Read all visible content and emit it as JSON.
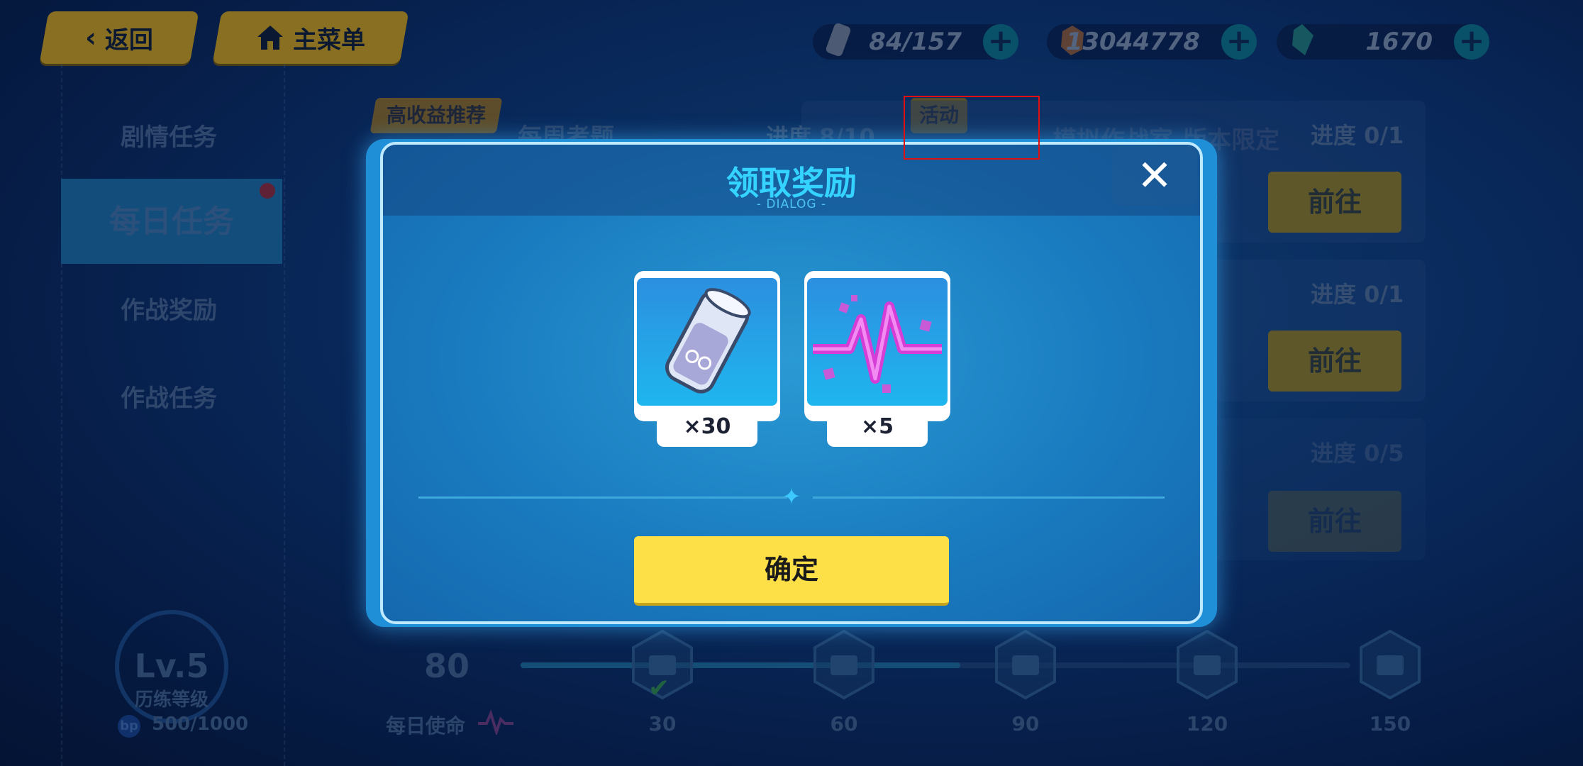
{
  "topbar": {
    "back_label": "返回",
    "main_menu_label": "主菜单",
    "resources": [
      {
        "icon": "stamina-can-icon",
        "value": "84/157"
      },
      {
        "icon": "coin-icon",
        "value": "13044778"
      },
      {
        "icon": "crystal-icon",
        "value": "1670"
      }
    ]
  },
  "sidebar": {
    "items": [
      "剧情任务",
      "每日任务",
      "作战奖励",
      "作战任务"
    ],
    "active_index": 1
  },
  "task_panel": {
    "tag_high_yield": "高收益推荐",
    "tag_event": "活动",
    "rows": [
      {
        "title": "每周考题",
        "progress": "进度 8/10",
        "partial_number": "0"
      },
      {
        "title": "模拟作战室-版本限定",
        "progress": "进度 0/1",
        "button": "前往"
      },
      {
        "progress": "进度 0/1",
        "button": "前往"
      },
      {
        "progress": "进度 0/5",
        "button": "前往"
      }
    ]
  },
  "level": {
    "level_text": "Lv.5",
    "level_caption": "历练等级",
    "bp_label": "bp",
    "bp_value": "500/1000"
  },
  "daily_mission": {
    "points": "80",
    "label": "每日使命",
    "milestones": [
      "30",
      "60",
      "90",
      "120",
      "150"
    ],
    "progress_fraction": 0.53
  },
  "dialog": {
    "title": "领取奖励",
    "subtitle": "- DIALOG -",
    "rewards": [
      {
        "icon": "stamina-can-icon",
        "count": "×30"
      },
      {
        "icon": "activity-pulse-icon",
        "count": "×5"
      }
    ],
    "confirm_label": "确定",
    "close_icon": "close-icon"
  },
  "colors": {
    "accent_cyan": "#35d3ff",
    "confirm_yellow": "#fde047",
    "annotation_red": "#e01010"
  }
}
